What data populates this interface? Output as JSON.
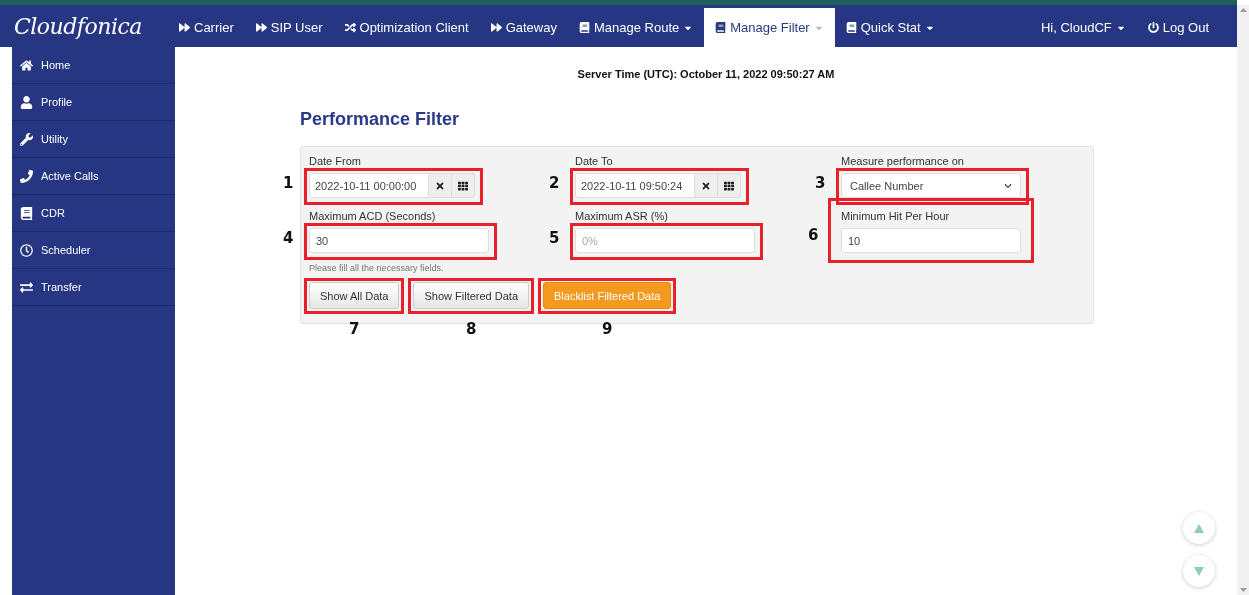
{
  "navbar": {
    "logo": "Cloudfonica",
    "items": [
      {
        "label": "Carrier",
        "selected": false
      },
      {
        "label": "SIP User",
        "selected": false
      },
      {
        "label": "Optimization Client",
        "selected": false
      },
      {
        "label": "Gateway",
        "selected": false
      },
      {
        "label": "Manage Route",
        "selected": false
      },
      {
        "label": "Manage Filter",
        "selected": true
      },
      {
        "label": "Quick Stat",
        "selected": false
      }
    ],
    "user": "Hi, CloudCF",
    "logout": "Log Out"
  },
  "sidebar": {
    "items": [
      {
        "label": "Home"
      },
      {
        "label": "Profile"
      },
      {
        "label": "Utility"
      },
      {
        "label": "Active Calls"
      },
      {
        "label": "CDR"
      },
      {
        "label": "Scheduler"
      },
      {
        "label": "Transfer"
      }
    ]
  },
  "server_time": "Server Time (UTC): October 11, 2022 09:50:27 AM",
  "page_title": "Performance Filter",
  "fields": [
    {
      "kind": "date",
      "label": "Date From",
      "value": "2022-10-11 00:00:00",
      "annotation": {
        "number": "1"
      }
    },
    {
      "kind": "date",
      "label": "Date To",
      "value": "2022-10-11 09:50:24",
      "annotation": {
        "number": "2"
      }
    },
    {
      "kind": "select",
      "label": "Measure performance on",
      "value": "Callee Number",
      "annotation": {
        "number": "3"
      }
    },
    {
      "kind": "text",
      "label": "Maximum ACD (Seconds)",
      "value": "30",
      "annotation": {
        "number": "4"
      }
    },
    {
      "kind": "text",
      "label": "Maximum ASR (%)",
      "placeholder": "0%",
      "annotation": {
        "number": "5"
      }
    },
    {
      "kind": "text",
      "label": "Minimum Hit Per Hour",
      "value": "10",
      "annotation": {
        "number": "6"
      }
    }
  ],
  "note": "Please fill all the necessary fields.",
  "buttons": [
    {
      "label": "Show All Data",
      "kind": "default",
      "annotation": {
        "number": "7"
      }
    },
    {
      "label": "Show Filtered Data",
      "kind": "default",
      "annotation": {
        "number": "8"
      }
    },
    {
      "label": "Blacklist Filtered Data",
      "kind": "warning",
      "annotation": {
        "number": "9"
      }
    }
  ]
}
